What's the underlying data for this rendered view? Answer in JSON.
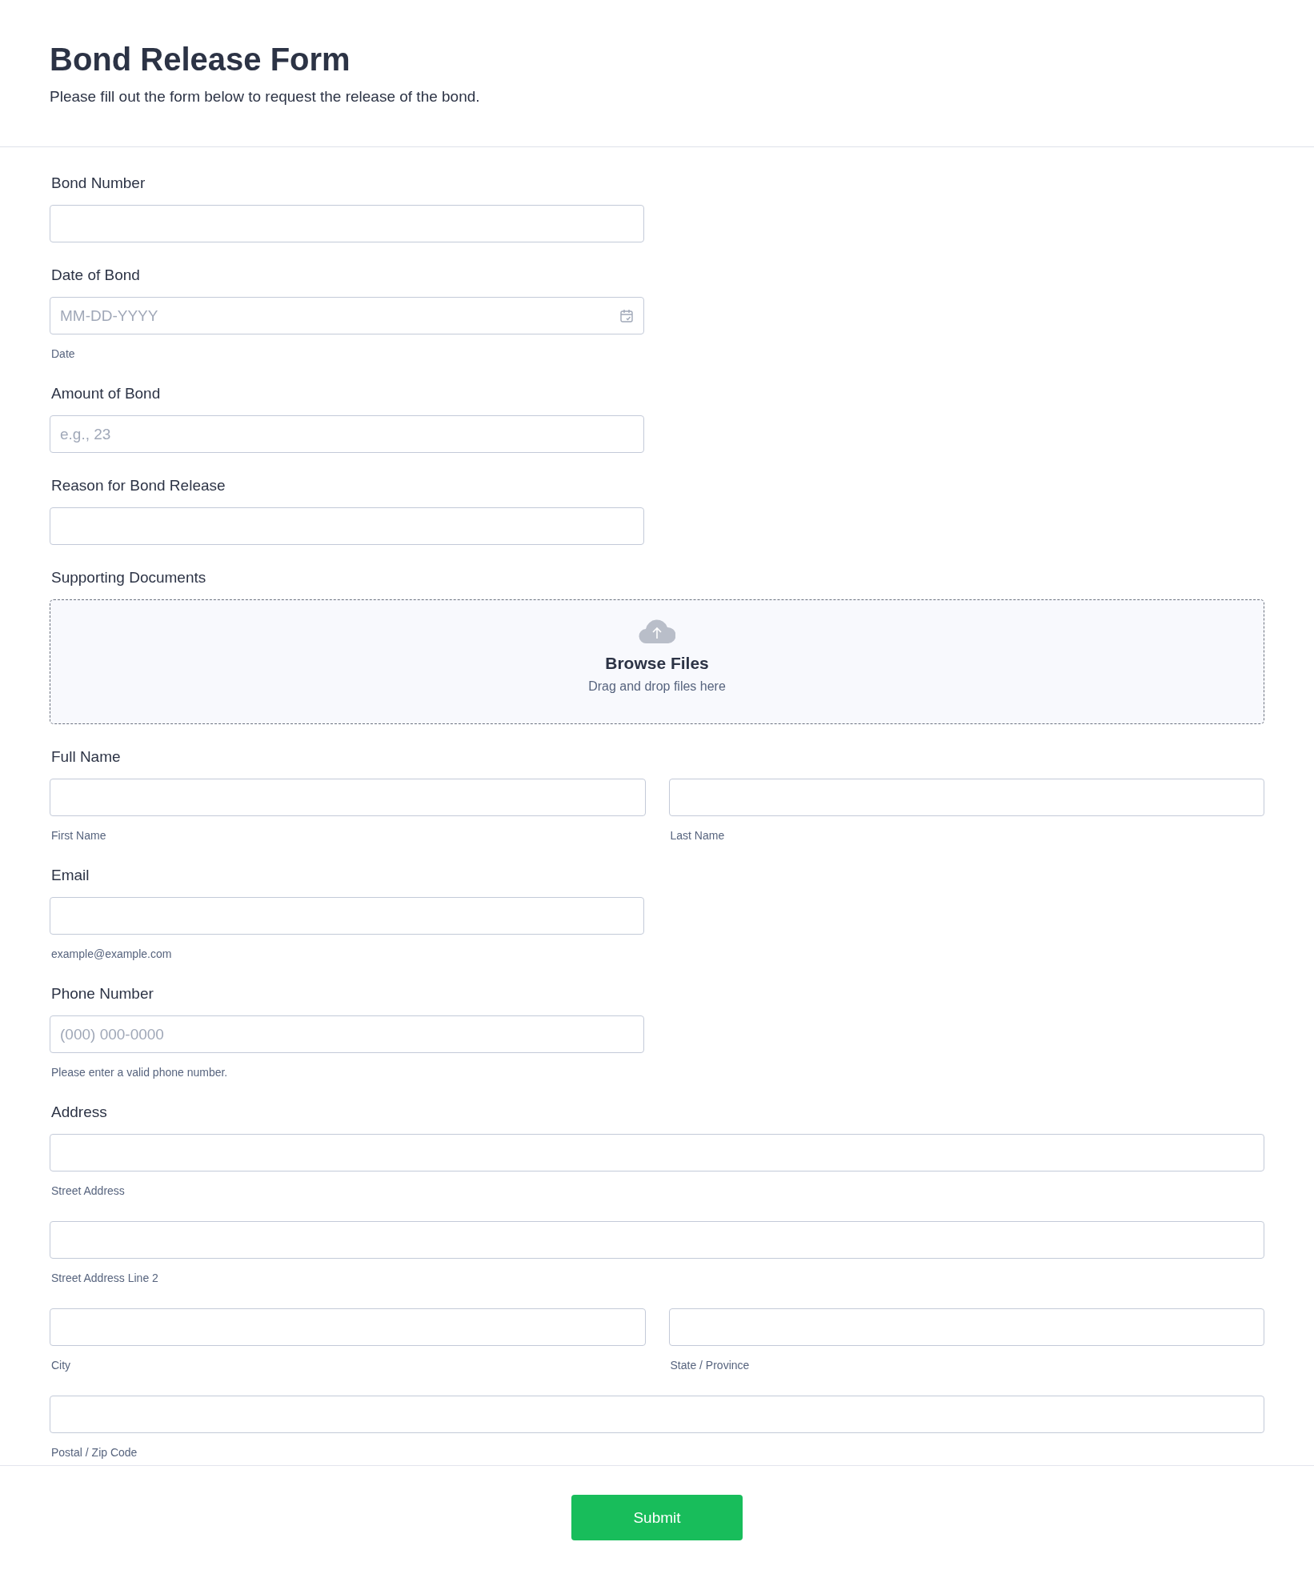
{
  "header": {
    "title": "Bond Release Form",
    "subtitle": "Please fill out the form below to request the release of the bond."
  },
  "fields": [
    {
      "kind": "text",
      "label": "Bond Number"
    },
    {
      "kind": "date",
      "label": "Date of Bond",
      "placeholder": "MM-DD-YYYY",
      "sublabel": "Date"
    },
    {
      "kind": "text",
      "label": "Amount of Bond",
      "placeholder": "e.g., 23"
    },
    {
      "kind": "text",
      "label": "Reason for Bond Release"
    },
    {
      "kind": "upload",
      "label": "Supporting Documents",
      "title": "Browse Files",
      "hint": "Drag and drop files here"
    },
    {
      "kind": "group",
      "label": "Full Name",
      "rows": [
        [
          {
            "sublabel": "First Name"
          },
          {
            "sublabel": "Last Name"
          }
        ]
      ]
    },
    {
      "kind": "text",
      "label": "Email",
      "sublabel": "example@example.com"
    },
    {
      "kind": "text",
      "label": "Phone Number",
      "placeholder": "(000) 000-0000",
      "sublabel": "Please enter a valid phone number."
    },
    {
      "kind": "group",
      "label": "Address",
      "rows": [
        [
          {
            "sublabel": "Street Address"
          }
        ],
        [
          {
            "sublabel": "Street Address Line 2"
          }
        ],
        [
          {
            "sublabel": "City"
          },
          {
            "sublabel": "State / Province"
          }
        ],
        [
          {
            "sublabel": "Postal / Zip Code"
          }
        ]
      ]
    }
  ],
  "submit": {
    "label": "Submit"
  }
}
